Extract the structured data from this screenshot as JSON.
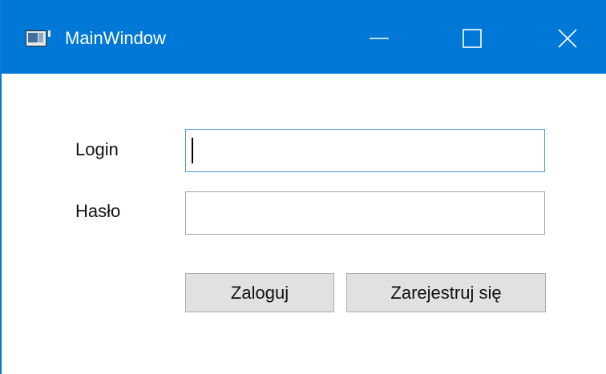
{
  "window": {
    "title": "MainWindow",
    "accent_color": "#0078d7",
    "icons": {
      "app": "window-app-icon",
      "minimize": "minimize-icon",
      "maximize": "maximize-icon",
      "close": "close-icon"
    }
  },
  "form": {
    "login_label": "Login",
    "login_value": "",
    "password_label": "Hasło",
    "password_value": "",
    "login_button": "Zaloguj",
    "register_button": "Zarejestruj się"
  }
}
